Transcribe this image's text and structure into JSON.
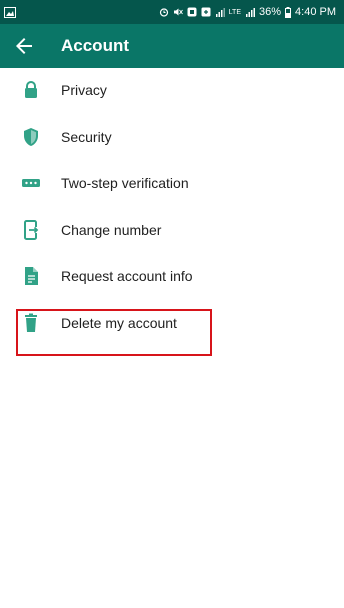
{
  "status_bar": {
    "battery": "36%",
    "time": "4:40 PM",
    "network": "LTE"
  },
  "app_bar": {
    "title": "Account",
    "back_icon": "arrow-back-icon"
  },
  "items": [
    {
      "label": "Privacy",
      "icon": "lock-icon"
    },
    {
      "label": "Security",
      "icon": "shield-icon"
    },
    {
      "label": "Two-step verification",
      "icon": "dots-icon"
    },
    {
      "label": "Change number",
      "icon": "phone-swap-icon"
    },
    {
      "label": "Request account info",
      "icon": "document-icon"
    },
    {
      "label": "Delete my account",
      "icon": "trash-icon"
    }
  ],
  "colors": {
    "app_bar": "#0a7667",
    "status_bar": "#05564c",
    "icon": "#31a287",
    "highlight": "#d7141a"
  }
}
